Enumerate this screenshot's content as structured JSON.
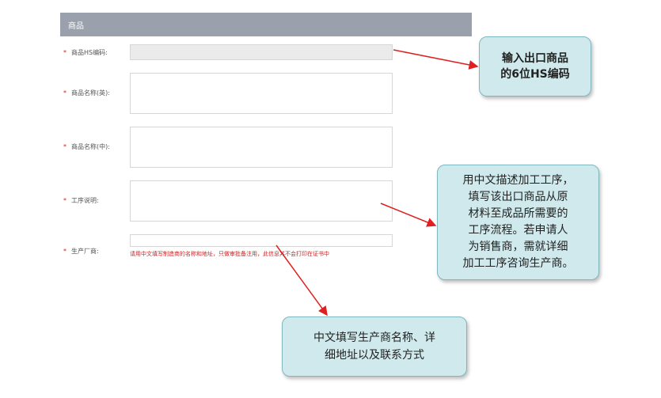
{
  "section": {
    "title": "商品"
  },
  "form": {
    "hs_code": {
      "label": "商品HS编码:",
      "value": ""
    },
    "name_en": {
      "label": "商品名称(英):",
      "value": ""
    },
    "name_cn": {
      "label": "商品名称(中):",
      "value": ""
    },
    "process": {
      "label": "工序说明:",
      "value": ""
    },
    "manufacturer": {
      "label": "生产厂商:",
      "value": "",
      "hint": "请用中文填写制造商的名称和地址，只做审批备注用，此信息并不会打印在证书中"
    },
    "required_mark": "*"
  },
  "callouts": {
    "hs": [
      "输入出口商品",
      "的6位HS编码"
    ],
    "process": [
      "用中文描述加工工序，",
      "填写该出口商品从原",
      "材料至成品所需要的",
      "工序流程。若申请人",
      "为销售商，需就详细",
      "加工工序咨询生产商。"
    ],
    "manufacturer": [
      "中文填写生产商名称、详",
      "细地址以及联系方式"
    ]
  },
  "colors": {
    "header_bg": "#9aa1ad",
    "required": "#d21f1f",
    "callout_bg": "#cfe9ec",
    "arrow": "#e02020"
  }
}
